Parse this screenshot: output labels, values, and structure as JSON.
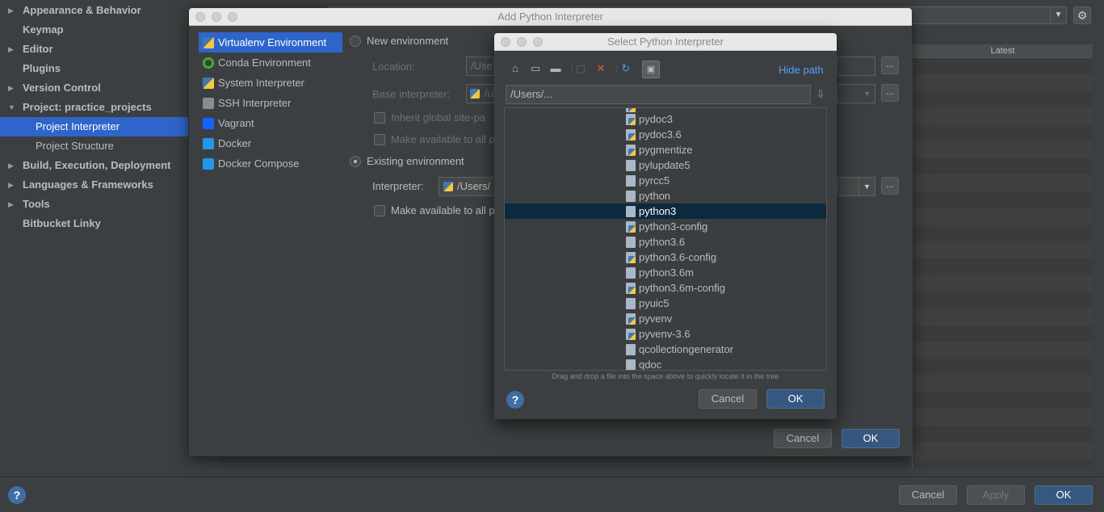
{
  "settings": {
    "tree": [
      {
        "label": "Appearance & Behavior",
        "arrow": "▶",
        "level": 0
      },
      {
        "label": "Keymap",
        "arrow": "",
        "level": 0
      },
      {
        "label": "Editor",
        "arrow": "▶",
        "level": 0
      },
      {
        "label": "Plugins",
        "arrow": "",
        "level": 0
      },
      {
        "label": "Version Control",
        "arrow": "▶",
        "level": 0
      },
      {
        "label": "Project: practice_projects",
        "arrow": "▼",
        "level": 0
      },
      {
        "label": "Project Interpreter",
        "arrow": "",
        "level": 1,
        "selected": true
      },
      {
        "label": "Project Structure",
        "arrow": "",
        "level": 1
      },
      {
        "label": "Build, Execution, Deployment",
        "arrow": "▶",
        "level": 0
      },
      {
        "label": "Languages & Frameworks",
        "arrow": "▶",
        "level": 0
      },
      {
        "label": "Tools",
        "arrow": "▶",
        "level": 0
      },
      {
        "label": "Bitbucket Linky",
        "arrow": "",
        "level": 0
      }
    ],
    "table_header": "Latest",
    "footer": {
      "cancel": "Cancel",
      "apply": "Apply",
      "ok": "OK",
      "help": "?"
    }
  },
  "add_dialog": {
    "title": "Add Python Interpreter",
    "env_types": [
      {
        "label": "Virtualenv Environment",
        "icon": "virtualenv-icon",
        "selected": true
      },
      {
        "label": "Conda Environment",
        "icon": "conda-icon"
      },
      {
        "label": "System Interpreter",
        "icon": "python-icon"
      },
      {
        "label": "SSH Interpreter",
        "icon": "ssh-icon"
      },
      {
        "label": "Vagrant",
        "icon": "vagrant-icon"
      },
      {
        "label": "Docker",
        "icon": "docker-icon"
      },
      {
        "label": "Docker Compose",
        "icon": "docker-compose-icon"
      }
    ],
    "new_env": "New environment",
    "location_label": "Location:",
    "location_value": "/Use",
    "base_interpreter_label": "Base interpreter:",
    "base_interpreter_value": "/u",
    "inherit_label": "Inherit global site-pa",
    "make_available_1": "Make available to all p",
    "existing_env": "Existing environment",
    "interpreter_label": "Interpreter:",
    "interpreter_value": "/Users/",
    "make_available_2": "Make available to all p",
    "cancel": "Cancel",
    "ok": "OK",
    "dots": "..."
  },
  "select_dialog": {
    "title": "Select Python Interpreter",
    "hide_path": "Hide path",
    "path": "/Users/...",
    "files": [
      {
        "name": "pydoc3",
        "py": true
      },
      {
        "name": "pydoc3.6",
        "py": true
      },
      {
        "name": "pygmentize",
        "py": true
      },
      {
        "name": "pylupdate5",
        "py": false
      },
      {
        "name": "pyrcc5",
        "py": false
      },
      {
        "name": "python",
        "py": false
      },
      {
        "name": "python3",
        "py": false,
        "selected": true
      },
      {
        "name": "python3-config",
        "py": true
      },
      {
        "name": "python3.6",
        "py": false
      },
      {
        "name": "python3.6-config",
        "py": true
      },
      {
        "name": "python3.6m",
        "py": false
      },
      {
        "name": "python3.6m-config",
        "py": true
      },
      {
        "name": "pyuic5",
        "py": false
      },
      {
        "name": "pyvenv",
        "py": true
      },
      {
        "name": "pyvenv-3.6",
        "py": true
      },
      {
        "name": "qcollectiongenerator",
        "py": false
      },
      {
        "name": "qdoc",
        "py": false
      }
    ],
    "hint": "Drag and drop a file into the space above to quickly locate it in the tree",
    "help": "?",
    "cancel": "Cancel",
    "ok": "OK"
  },
  "colors": {
    "accent": "#2f65ca",
    "primary_button": "#365880",
    "link": "#589df6",
    "tree_selection": "#0d293e"
  }
}
